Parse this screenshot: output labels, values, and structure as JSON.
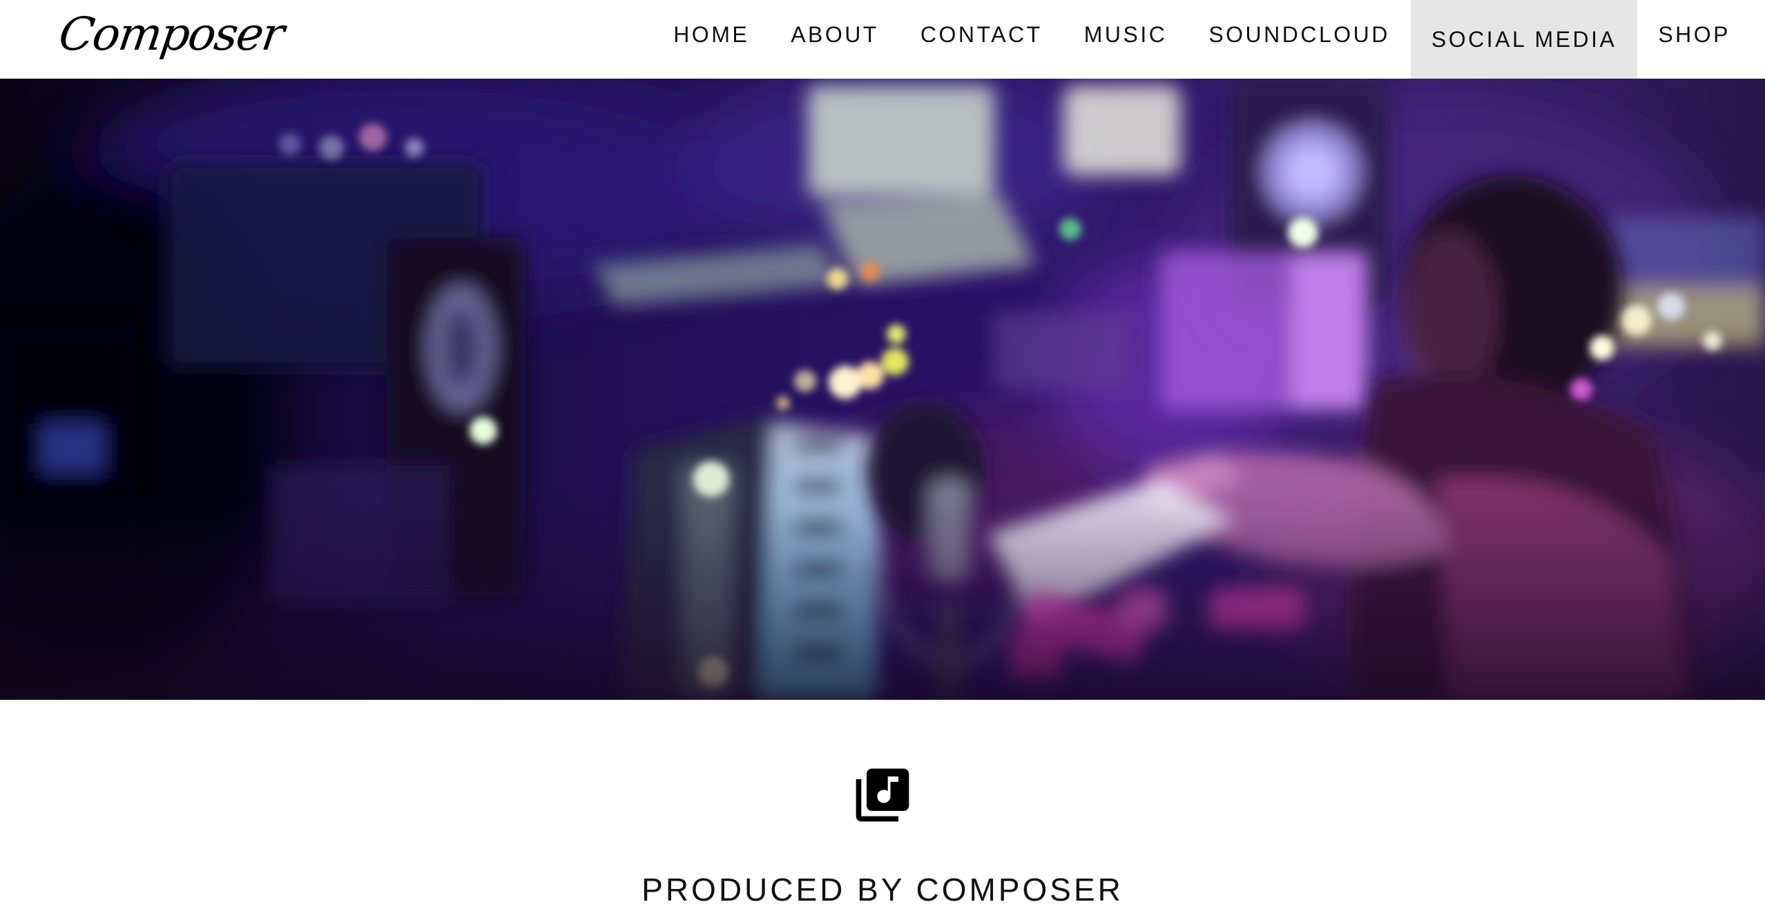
{
  "header": {
    "logo_text": "Composer",
    "nav": [
      {
        "label": "HOME"
      },
      {
        "label": "ABOUT"
      },
      {
        "label": "CONTACT"
      },
      {
        "label": "MUSIC"
      },
      {
        "label": "SOUNDCLOUD"
      },
      {
        "label": "SOCIAL MEDIA",
        "active": true
      },
      {
        "label": "SHOP"
      }
    ]
  },
  "hero": {
    "image": "blurred-music-studio-photo"
  },
  "section": {
    "icon": "music-library-icon",
    "title": "PRODUCED BY COMPOSER"
  },
  "colors": {
    "nav_active_bg": "#e6e6e6",
    "text": "#111111",
    "hero_dark": "#1a0a2e"
  }
}
